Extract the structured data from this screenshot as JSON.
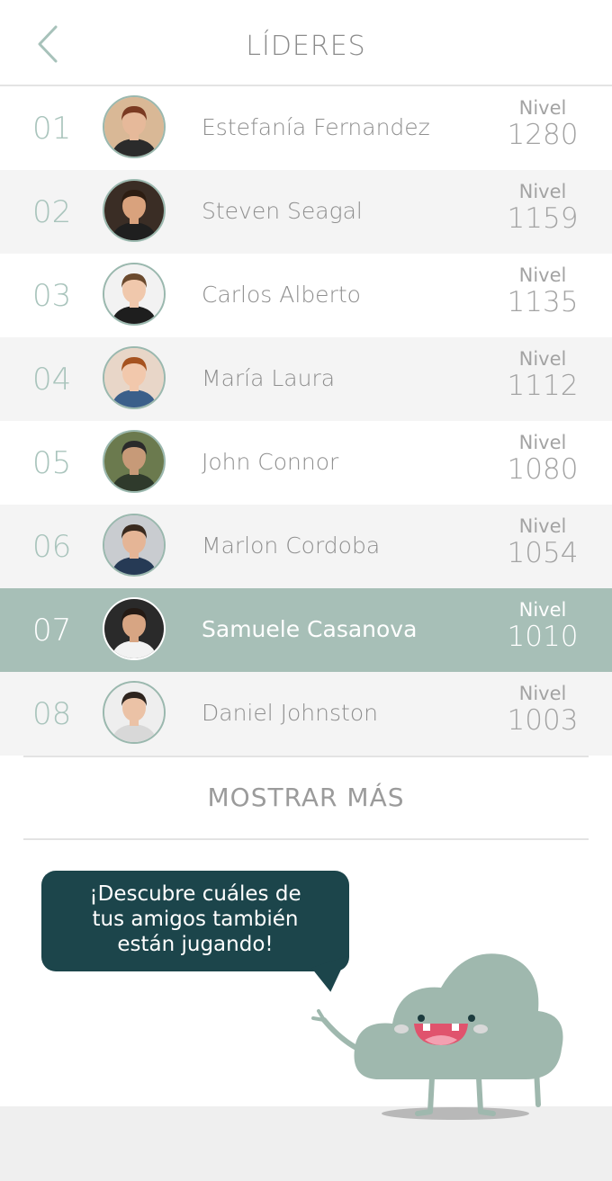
{
  "header": {
    "title": "LÍDERES",
    "back_icon": "chevron-left-icon"
  },
  "leaderboard": [
    {
      "rank": "01",
      "name": "Estefanía Fernandez",
      "level_label": "Nivel",
      "level": "1280",
      "avatar_skin": "#e6b99a",
      "avatar_hair": "#7a3a22",
      "avatar_bg": "#d9b896",
      "avatar_shirt": "#2b2b2b"
    },
    {
      "rank": "02",
      "name": "Steven Seagal",
      "level_label": "Nivel",
      "level": "1159",
      "avatar_skin": "#d9a27d",
      "avatar_hair": "#2d1d12",
      "avatar_bg": "#3a2d25",
      "avatar_shirt": "#1f1f1f"
    },
    {
      "rank": "03",
      "name": "Carlos Alberto",
      "level_label": "Nivel",
      "level": "1135",
      "avatar_skin": "#f0c8ac",
      "avatar_hair": "#6b4a2e",
      "avatar_bg": "#f2f2f2",
      "avatar_shirt": "#1e1e1e"
    },
    {
      "rank": "04",
      "name": "María Laura",
      "level_label": "Nivel",
      "level": "1112",
      "avatar_skin": "#f2c8ac",
      "avatar_hair": "#a6521f",
      "avatar_bg": "#e8d6c8",
      "avatar_shirt": "#3b5f8a"
    },
    {
      "rank": "05",
      "name": "John Connor",
      "level_label": "Nivel",
      "level": "1080",
      "avatar_skin": "#c79a78",
      "avatar_hair": "#2a2a2a",
      "avatar_bg": "#6b7a4e",
      "avatar_shirt": "#2f3a2c"
    },
    {
      "rank": "06",
      "name": "Marlon Cordoba",
      "level_label": "Nivel",
      "level": "1054",
      "avatar_skin": "#e5b596",
      "avatar_hair": "#3a2a1f",
      "avatar_bg": "#c9ccd0",
      "avatar_shirt": "#263a55"
    },
    {
      "rank": "07",
      "name": "Samuele Casanova",
      "level_label": "Nivel",
      "level": "1010",
      "avatar_skin": "#d7a583",
      "avatar_hair": "#241a14",
      "avatar_bg": "#2a2a2a",
      "avatar_shirt": "#f2f2f2"
    },
    {
      "rank": "08",
      "name": "Daniel Johnston",
      "level_label": "Nivel",
      "level": "1003",
      "avatar_skin": "#ebc2a6",
      "avatar_hair": "#2e241e",
      "avatar_bg": "#eeeeee",
      "avatar_shirt": "#d8d8d8"
    }
  ],
  "current_user_rank": "07",
  "show_more_label": "MOSTRAR MÁS",
  "speech_bubble": {
    "lines": [
      "¡Descubre cuáles de",
      "tus amigos también",
      "están jugando!"
    ]
  },
  "colors": {
    "accent": "#a7bfb7",
    "rank_text": "#a9c4bc",
    "bubble": "#1c454b",
    "mascot": "#9fb8ae"
  }
}
